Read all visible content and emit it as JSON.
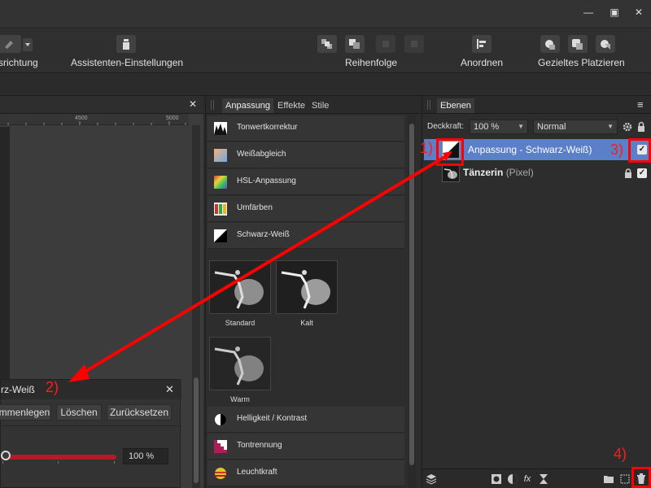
{
  "window": {
    "minimize": "—",
    "restore": "▣",
    "close": "✕"
  },
  "toolbar": {
    "snapping_label": "srichtung",
    "assistant_label": "Assistenten-Einstellungen",
    "order_label": "Reihenfolge",
    "arrange_label": "Anordnen",
    "placement_label": "Gezieltes Platzieren"
  },
  "canvas": {
    "close": "✕",
    "ruler": [
      "4500",
      "5000"
    ]
  },
  "dialog": {
    "title": "rz-Weiß",
    "close": "✕",
    "merge_button": "mmenlegen",
    "delete_button": "Löschen",
    "reset_button": "Zurücksetzen",
    "slider_value": "100 %"
  },
  "adjustments": {
    "tabs": [
      "Anpassung",
      "Effekte",
      "Stile"
    ],
    "items_top": [
      "Tonwertkorrektur",
      "Weißabgleich",
      "HSL-Anpassung",
      "Umfärben",
      "Schwarz-Weiß"
    ],
    "presets": [
      "Standard",
      "Kalt",
      "Warm"
    ],
    "items_bottom": [
      "Helligkeit / Kontrast",
      "Tontrennung",
      "Leuchtkraft"
    ]
  },
  "layers": {
    "tab": "Ebenen",
    "menu": "≡",
    "opacity_label": "Deckkraft:",
    "opacity_value": "100 %",
    "blend_mode": "Normal",
    "layer1": "Anpassung - Schwarz-Weiß)",
    "layer2_name": "Tänzerin",
    "layer2_type": "(Pixel)",
    "check": "✓",
    "fx": "fx"
  },
  "annotations": {
    "a1": "1)",
    "a2": "2)",
    "a3": "3)",
    "a4": "4)"
  },
  "colors": {
    "accent": "#5b7fc8",
    "annotation": "#ff0000",
    "slider": "#b01c2a"
  }
}
